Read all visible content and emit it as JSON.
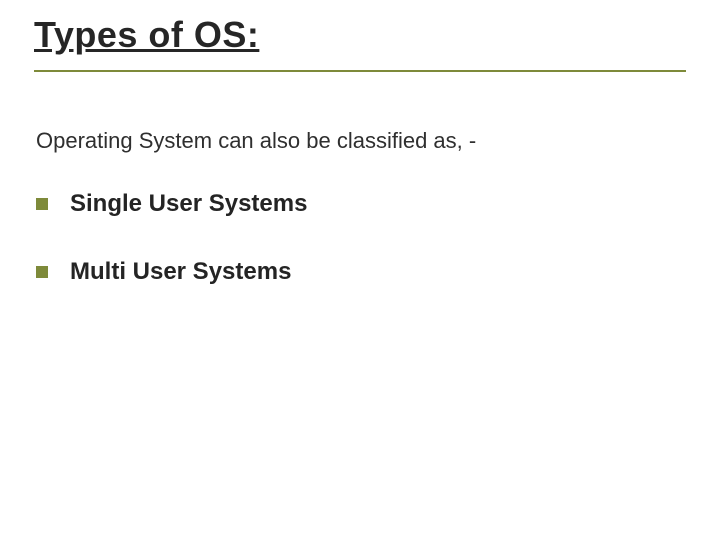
{
  "slide": {
    "title": "Types of OS:",
    "intro": "Operating System can also be classified as, -",
    "bullets": [
      {
        "text": "Single User Systems"
      },
      {
        "text": "Multi User Systems"
      }
    ]
  }
}
